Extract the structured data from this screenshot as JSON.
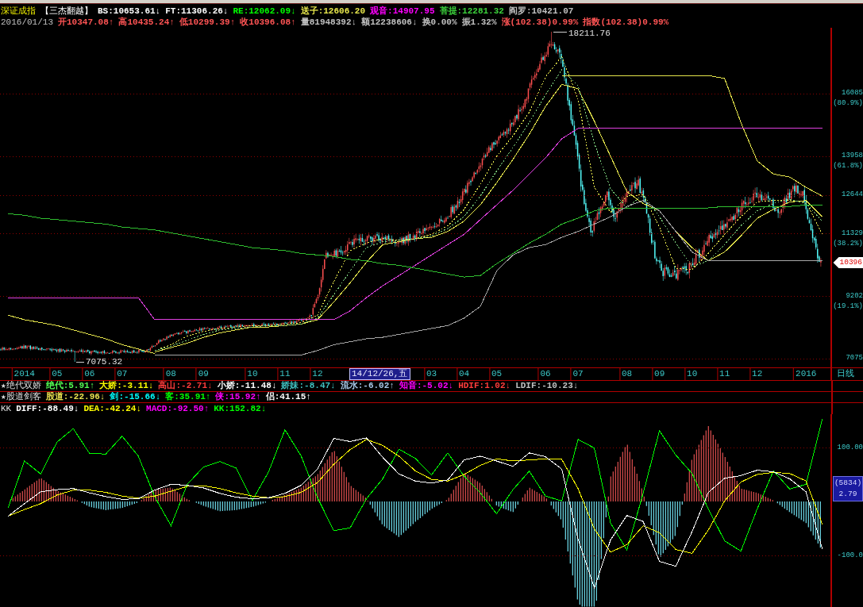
{
  "title_bar": {
    "index_name": "深证成指",
    "formula": "【三杰翻越】",
    "items": [
      {
        "text": "BS:10653.61↓",
        "color": "#ffffff"
      },
      {
        "text": "FT:11306.26↓",
        "color": "#ffffff"
      },
      {
        "text": "RE:12062.09↓",
        "color": "#00ff00"
      },
      {
        "text": "送子:12606.20",
        "color": "#e8e84c"
      },
      {
        "text": "观音:14907.95",
        "color": "#ff00ff"
      },
      {
        "text": "菩提:12281.32",
        "color": "#3cd23c"
      },
      {
        "text": "阎罗:10421.07",
        "color": "#c0c0c0"
      }
    ]
  },
  "quote_line": {
    "date": "2016/01/13",
    "items": [
      {
        "text": "开10347.08↑",
        "color": "#ff5454"
      },
      {
        "text": "高10435.24↑",
        "color": "#ff5454"
      },
      {
        "text": "低10299.39↑",
        "color": "#ff5454"
      },
      {
        "text": "收10396.08↑",
        "color": "#ff5454"
      },
      {
        "text": "量81948392↓",
        "color": "#c0c0c0"
      },
      {
        "text": "额12238606↓",
        "color": "#c0c0c0"
      },
      {
        "text": "换0.00%",
        "color": "#c0c0c0"
      },
      {
        "text": "振1.32%",
        "color": "#c0c0c0"
      },
      {
        "text": "涨(102.38)0.99%",
        "color": "#ff5454"
      },
      {
        "text": "指数(102.38)0.99%",
        "color": "#ff5454"
      }
    ]
  },
  "price_chart": {
    "chart_data": {
      "type": "line",
      "grid": true,
      "categories": [
        null,
        "2014",
        null,
        "05",
        null,
        "06",
        null,
        "07",
        null,
        null,
        "08",
        null,
        "09",
        null,
        null,
        "10",
        null,
        "11",
        null,
        "12",
        null,
        null,
        null,
        null,
        null,
        null,
        "03",
        null,
        "04",
        null,
        "05",
        null,
        null,
        "06",
        null,
        "07",
        null,
        null,
        "08",
        null,
        "09",
        null,
        "10",
        null,
        "11",
        null,
        "12",
        null,
        null,
        "2016",
        null
      ],
      "ylim": [
        6778,
        18324
      ],
      "yticks": [
        {
          "value": 16085,
          "label": "16085"
        },
        {
          "value": 13958,
          "label": "13958"
        },
        {
          "value": 12644,
          "label": "12644"
        },
        {
          "value": 11329,
          "label": "11329"
        },
        {
          "value": 9202,
          "label": "9202"
        },
        {
          "value": 7075,
          "label": "7075"
        }
      ],
      "series": [
        {
          "color": "#e6e64c",
          "line_style": "solid",
          "values": [
            null,
            null,
            null,
            null,
            null,
            null,
            null,
            null,
            null,
            7300,
            7450,
            7600,
            7800,
            7950,
            8050,
            8150,
            8150,
            8200,
            8250,
            8400,
            9000,
            9650,
            10350,
            10950,
            11050,
            11150,
            11200,
            11400,
            11750,
            12300,
            13050,
            13850,
            14700,
            15650,
            16400,
            16250,
            15150,
            13950,
            12750,
            12350,
            12100,
            11400,
            10850,
            10400,
            10700,
            11250,
            11850,
            12150,
            12400,
            12450,
            11900
          ]
        },
        {
          "color": "#e6e64c",
          "line_style": "dashed",
          "values": [
            null,
            null,
            null,
            null,
            null,
            null,
            null,
            null,
            null,
            7350,
            7550,
            7850,
            8000,
            8100,
            8150,
            8200,
            8200,
            8250,
            8300,
            8550,
            9700,
            10750,
            11000,
            11150,
            11100,
            11150,
            11300,
            11600,
            12150,
            13000,
            13950,
            14650,
            15450,
            16650,
            17350,
            15900,
            12900,
            12050,
            12600,
            12650,
            11550,
            10150,
            10100,
            10650,
            11300,
            11900,
            12400,
            12450,
            12450,
            12400,
            11300
          ]
        },
        {
          "color": "#7cd07c",
          "line_style": "dashed",
          "values": [
            null,
            null,
            null,
            null,
            null,
            null,
            null,
            null,
            null,
            7350,
            7500,
            7700,
            7900,
            8050,
            8100,
            8150,
            8200,
            8200,
            8250,
            8450,
            9250,
            10050,
            10850,
            11050,
            11100,
            11150,
            11250,
            11500,
            11900,
            12600,
            13450,
            14250,
            15100,
            16050,
            16900,
            16350,
            14400,
            12850,
            12200,
            12650,
            11900,
            11000,
            10200,
            10400,
            10950,
            11600,
            12100,
            12350,
            12500,
            12350,
            11750
          ]
        },
        {
          "color": "#e6e64c",
          "line_style": "solid",
          "values": [
            8550,
            8400,
            8300,
            8200,
            8050,
            7900,
            7750,
            7550,
            7400,
            7250,
            null,
            null,
            null,
            null,
            null,
            null,
            null,
            null,
            null,
            null,
            null,
            null,
            null,
            null,
            null,
            null,
            null,
            null,
            null,
            null,
            null,
            null,
            null,
            null,
            16700,
            16700,
            16700,
            16700,
            16700,
            16700,
            16700,
            16700,
            16700,
            16700,
            16600,
            15100,
            13800,
            13350,
            13250,
            12900,
            12600
          ]
        },
        {
          "color": "#e040e0",
          "line_style": "solid",
          "values": [
            9150,
            9150,
            9150,
            9150,
            9150,
            9150,
            9150,
            9150,
            9150,
            8400,
            8400,
            8400,
            8400,
            8400,
            8400,
            8400,
            8400,
            8400,
            8400,
            8400,
            8400,
            8700,
            9150,
            9550,
            9900,
            10250,
            10600,
            10950,
            11300,
            11800,
            12300,
            12800,
            13350,
            13900,
            14550,
            14900,
            14900,
            14900,
            14900,
            14900,
            14900,
            14900,
            14900,
            14900,
            14900,
            14900,
            14900,
            14900,
            14900,
            14900,
            14900
          ]
        },
        {
          "color": "#30c030",
          "line_style": "solid",
          "values": [
            12000,
            11950,
            11850,
            11800,
            11750,
            11700,
            11650,
            11550,
            11500,
            11450,
            11350,
            11250,
            11150,
            11050,
            10950,
            10850,
            10800,
            10750,
            10650,
            10600,
            10550,
            10450,
            10400,
            10300,
            10250,
            10150,
            10050,
            9950,
            9850,
            9900,
            10300,
            10650,
            11000,
            11300,
            11650,
            11850,
            12100,
            12200,
            12200,
            12200,
            12200,
            12200,
            12200,
            12200,
            12250,
            12250,
            12250,
            12250,
            12250,
            12300,
            12300
          ]
        },
        {
          "color": "#a8a8a8",
          "line_style": "solid",
          "values": [
            null,
            null,
            null,
            null,
            null,
            null,
            null,
            null,
            null,
            7200,
            7200,
            7200,
            7200,
            7200,
            7200,
            7200,
            7200,
            7200,
            7200,
            7350,
            7550,
            7650,
            7750,
            7800,
            7900,
            8000,
            8100,
            8200,
            8450,
            8850,
            10050,
            10600,
            10850,
            10950,
            11200,
            11400,
            11650,
            11900,
            12250,
            12450,
            12100,
            11400,
            10700,
            10400,
            10400,
            10400,
            10400,
            10400,
            10400,
            10400,
            10400
          ]
        }
      ],
      "annotations": [
        "18211.76",
        "7075.32",
        "14/12/26,五"
      ]
    },
    "ratio_labels": [
      "(80.9%)",
      "(61.8%)",
      "(38.2%)",
      "(19.1%)"
    ],
    "last_price": "10396"
  },
  "date_axis": {
    "period": "日线"
  },
  "indicators": [
    {
      "name": "★绝代双娇",
      "items": [
        {
          "text": "绝代:5.91↑",
          "color": "#54fc54"
        },
        {
          "text": "大娇:-3.11↓",
          "color": "#ffff00"
        },
        {
          "text": "高山:-2.71↓",
          "color": "#ff3c3c"
        },
        {
          "text": "小娇:-11.48↓",
          "color": "#ffffff"
        },
        {
          "text": "娇妹:-8.47↓",
          "color": "#40c0c0"
        },
        {
          "text": "流水:-6.02↑",
          "color": "#a8c8e8"
        },
        {
          "text": "知音:-5.02↓",
          "color": "#ff00ff"
        },
        {
          "text": "HDIF:1.02↓",
          "color": "#ff3c3c"
        },
        {
          "text": "LDIF:-10.23↓",
          "color": "#c0c0c0"
        }
      ]
    },
    {
      "name": "★股道剑客",
      "items": [
        {
          "text": "股道:-22.96↓",
          "color": "#e8e050"
        },
        {
          "text": "剑:-15.66↓",
          "color": "#00ffff"
        },
        {
          "text": "客:35.91↑",
          "color": "#00ff00"
        },
        {
          "text": "侠:15.92↑",
          "color": "#ff00ff"
        },
        {
          "text": "侣:41.15↑",
          "color": "#ffffff"
        }
      ]
    }
  ],
  "macd_panel": {
    "name": "KK",
    "items": [
      {
        "text": "DIFF:-88.49↓",
        "color": "#ffffff"
      },
      {
        "text": "DEA:-42.24↓",
        "color": "#ffff00"
      },
      {
        "text": "MACD:-92.50↑",
        "color": "#ff00ff"
      },
      {
        "text": "KK:152.82↓",
        "color": "#00ff00"
      }
    ],
    "chart_data": {
      "type": "line",
      "grid": true,
      "categories": [
        null,
        null,
        null,
        null,
        null,
        null,
        null,
        null,
        null,
        null,
        null,
        null,
        null,
        null,
        null,
        null,
        null,
        null,
        null,
        null,
        null,
        null,
        null,
        null,
        null,
        null,
        null,
        null,
        null,
        null,
        null,
        null,
        null,
        null,
        null,
        null,
        null,
        null,
        null,
        null,
        null,
        null,
        null,
        null,
        null,
        null,
        null,
        null,
        null,
        null,
        null
      ],
      "ylim": [
        -195.6,
        161.8
      ],
      "yticks": [
        {
          "value": 100,
          "label": "100.00"
        },
        {
          "value": -100,
          "label": "-100.0"
        }
      ],
      "series": [
        {
          "color": "#ffffff",
          "line_style": "solid",
          "values": [
            -27,
            -4,
            18,
            22,
            24,
            16,
            9,
            4,
            5,
            21,
            32,
            30,
            25,
            15,
            8,
            5,
            7,
            15,
            30,
            60,
            117,
            111,
            118,
            82,
            51,
            38,
            34,
            40,
            77,
            84,
            75,
            65,
            90,
            83,
            60,
            -70,
            -160,
            -71,
            -26,
            -37,
            -111,
            -120,
            -56,
            17,
            43,
            48,
            58,
            55,
            42,
            18,
            -88
          ]
        },
        {
          "color": "#ffff00",
          "line_style": "solid",
          "values": [
            -27,
            -15,
            -4,
            12,
            21,
            21,
            17,
            10,
            6,
            10,
            19,
            28,
            29,
            24,
            16,
            10,
            7,
            9,
            17,
            35,
            69,
            96,
            115,
            104,
            84,
            57,
            41,
            38,
            50,
            67,
            79,
            75,
            77,
            79,
            78,
            24,
            -51,
            -94,
            -80,
            -45,
            -58,
            -89,
            -96,
            -53,
            1,
            36,
            50,
            54,
            52,
            38,
            -42
          ]
        },
        {
          "color": "#00ff00",
          "line_style": "solid",
          "values": [
            -12,
            75,
            51,
            110,
            135,
            89,
            88,
            121,
            84,
            9,
            -45,
            32,
            64,
            74,
            62,
            2,
            55,
            133,
            84,
            7,
            -54,
            -49,
            5,
            42,
            97,
            80,
            49,
            90,
            47,
            16,
            -23,
            22,
            56,
            10,
            1,
            115,
            99,
            -40,
            -90,
            15,
            131,
            86,
            52,
            -14,
            -73,
            -92,
            -14,
            57,
            23,
            32,
            153
          ]
        }
      ]
    },
    "readout": {
      "volume": "(5834)",
      "value": "2.79"
    }
  }
}
